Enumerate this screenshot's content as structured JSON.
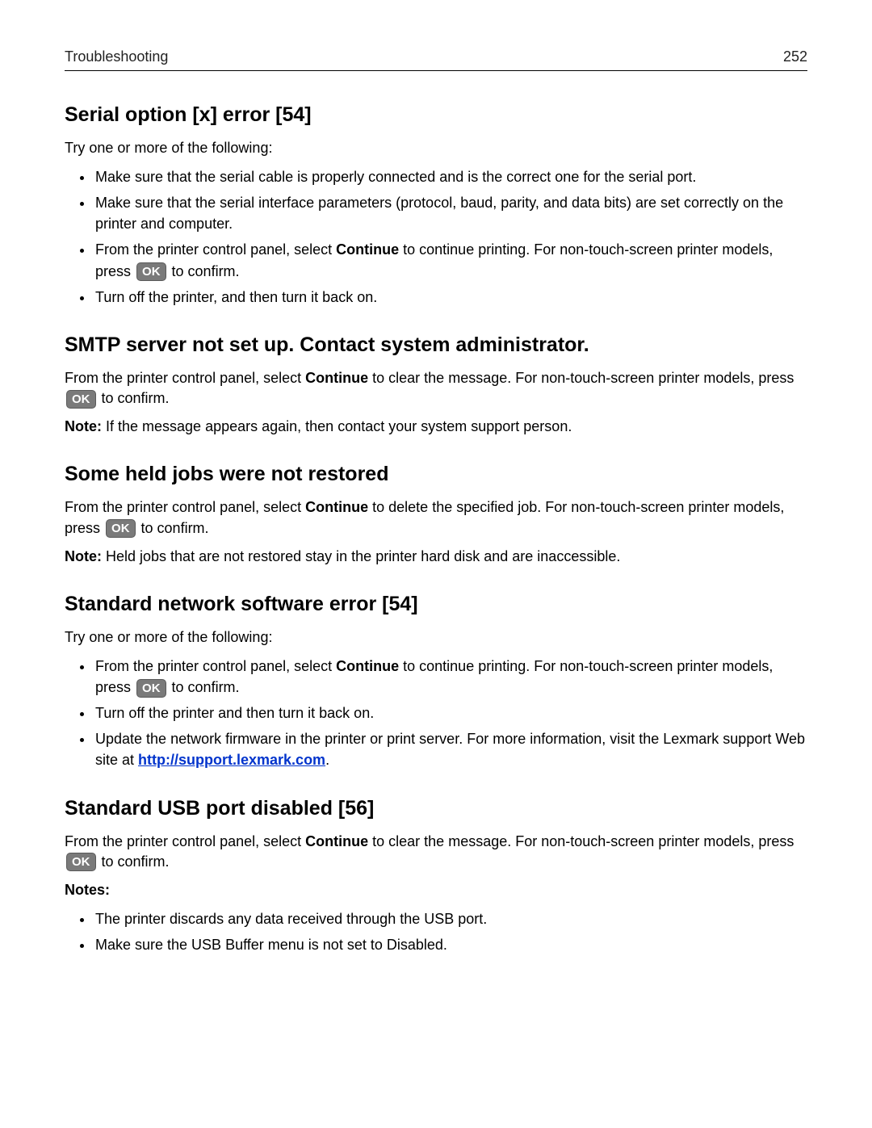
{
  "header": {
    "section": "Troubleshooting",
    "page": "252"
  },
  "ok_label": "OK",
  "sec1": {
    "title": "Serial option [x] error [54]",
    "intro": "Try one or more of the following:",
    "b1": "Make sure that the serial cable is properly connected and is the correct one for the serial port.",
    "b2": "Make sure that the serial interface parameters (protocol, baud, parity, and data bits) are set correctly on the printer and computer.",
    "b3_a": "From the printer control panel, select ",
    "b3_bold": "Continue",
    "b3_b": " to continue printing. For non‑touch‑screen printer models, press ",
    "b3_c": " to confirm.",
    "b4": "Turn off the printer, and then turn it back on."
  },
  "sec2": {
    "title": "SMTP server not set up. Contact system administrator.",
    "p1_a": "From the printer control panel, select ",
    "p1_bold": "Continue",
    "p1_b": " to clear the message. For non‑touch‑screen printer models, press ",
    "p1_c": " to confirm.",
    "note_label": "Note:",
    "note_text": " If the message appears again, then contact your system support person."
  },
  "sec3": {
    "title": "Some held jobs were not restored",
    "p1_a": "From the printer control panel, select ",
    "p1_bold": "Continue",
    "p1_b": " to delete the specified job. For non‑touch‑screen printer models, press ",
    "p1_c": " to confirm.",
    "note_label": "Note:",
    "note_text": " Held jobs that are not restored stay in the printer hard disk and are inaccessible."
  },
  "sec4": {
    "title": "Standard network software error [54]",
    "intro": "Try one or more of the following:",
    "b1_a": "From the printer control panel, select ",
    "b1_bold": "Continue",
    "b1_b": " to continue printing. For non‑touch‑screen printer models, press ",
    "b1_c": " to confirm.",
    "b2": "Turn off the printer and then turn it back on.",
    "b3_a": "Update the network firmware in the printer or print server. For more information, visit the Lexmark support Web site at ",
    "b3_link": "http://support.lexmark.com",
    "b3_b": "."
  },
  "sec5": {
    "title": "Standard USB port disabled [56]",
    "p1_a": "From the printer control panel, select ",
    "p1_bold": "Continue",
    "p1_b": " to clear the message. For non‑touch‑screen printer models, press ",
    "p1_c": " to confirm.",
    "notes_label": "Notes:",
    "n1": "The printer discards any data received through the USB port.",
    "n2": "Make sure the USB Buffer menu is not set to Disabled."
  }
}
